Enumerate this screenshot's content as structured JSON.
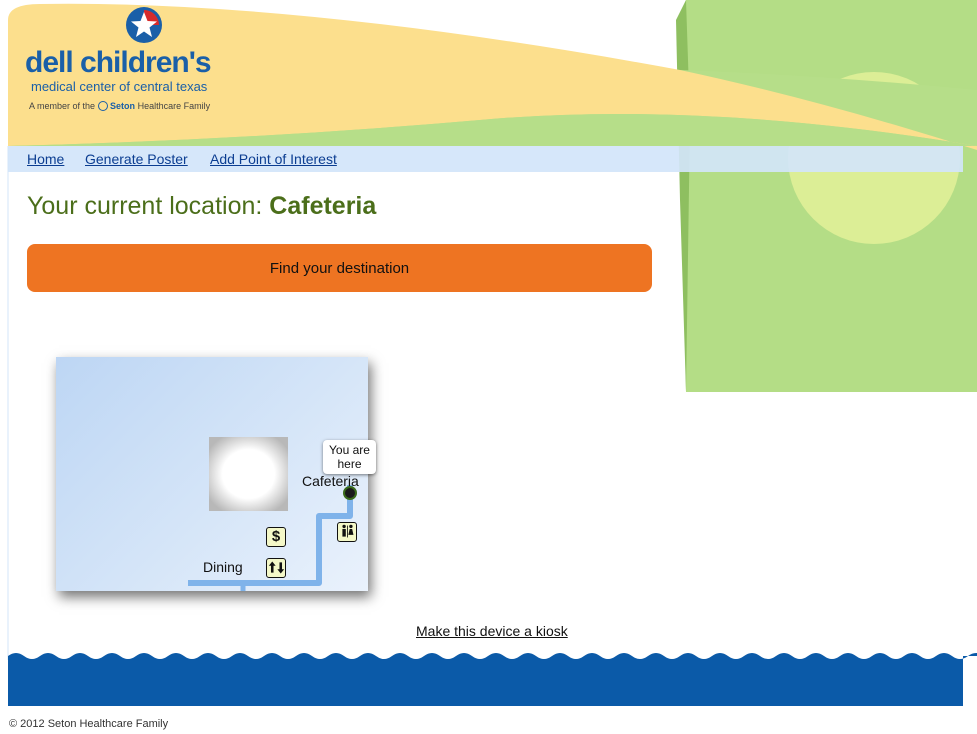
{
  "logo": {
    "brand": "dell children's",
    "subtitle": "medical center of central texas",
    "member_prefix": "A member of the",
    "member_org_bold": "Seton",
    "member_org_rest": " Healthcare Family"
  },
  "nav": {
    "items": [
      {
        "label": "Home"
      },
      {
        "label": "Generate Poster"
      },
      {
        "label": "Add Point of Interest"
      }
    ]
  },
  "location": {
    "prefix": "Your current location: ",
    "name": "Cafeteria"
  },
  "find_button": {
    "label": "Find your destination"
  },
  "map": {
    "you_are_here_line1": "You are",
    "you_are_here_line2": "here",
    "labels": {
      "cafeteria": "Cafeteria",
      "dining": "Dining"
    },
    "icons": [
      "restroom-icon",
      "dollar-icon",
      "elevator-icon",
      "you-are-here-marker-icon"
    ]
  },
  "kiosk_link": {
    "label": "Make this device a kiosk"
  },
  "footer": {
    "copyright": "© 2012 Seton Healthcare Family"
  },
  "colors": {
    "header_yellow": "#fce08f",
    "header_green": "#b5dd88",
    "nav_blue": "#d3e5fa",
    "heading_green": "#4b6e1a",
    "button_orange": "#ee7422",
    "wave_blue": "#0b5aa8",
    "route_blue": "#7fb3ea",
    "brand_blue": "#1a5fa8"
  }
}
